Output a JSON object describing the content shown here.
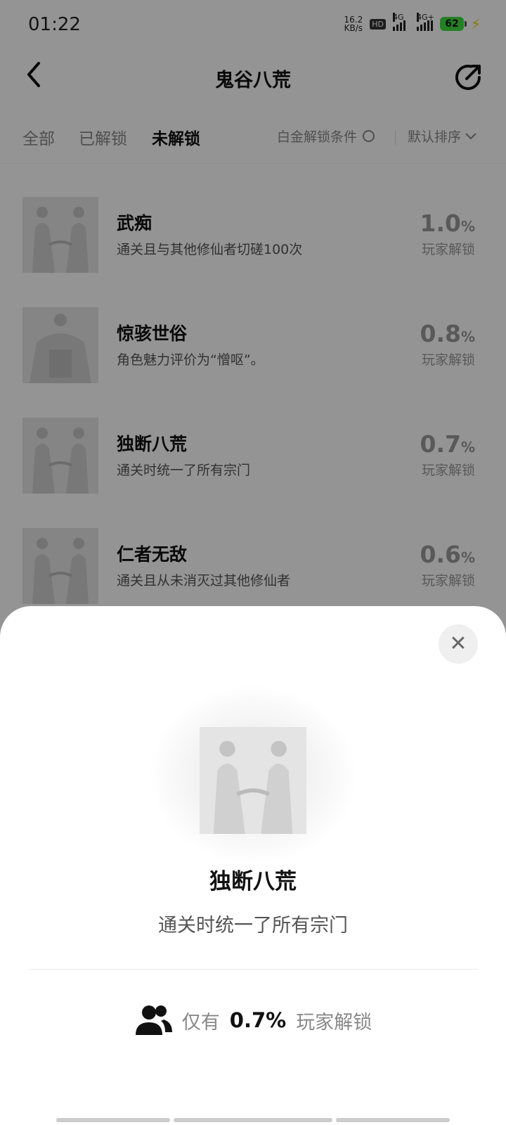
{
  "status": {
    "time": "01:22",
    "net_speed_value": "16.2",
    "net_speed_unit": "KB/s",
    "hd": "HD",
    "sim1": "4G",
    "sim2": "4G+",
    "battery": "62"
  },
  "header": {
    "title": "鬼谷八荒"
  },
  "tabs": [
    "全部",
    "已解锁",
    "未解锁"
  ],
  "filters": {
    "platinum": "白金解锁条件",
    "sort": "默认排序"
  },
  "achievements": [
    {
      "title": "武痴",
      "desc": "通关且与其他修仙者切磋100次",
      "pct": "1.0",
      "pct_unit": "%",
      "unlock": "玩家解锁",
      "icon": "two-figures"
    },
    {
      "title": "惊骇世俗",
      "desc": "角色魅力评价为“憎呕”。",
      "pct": "0.8",
      "pct_unit": "%",
      "unlock": "玩家解锁",
      "icon": "single-figure"
    },
    {
      "title": "独断八荒",
      "desc": "通关时统一了所有宗门",
      "pct": "0.7",
      "pct_unit": "%",
      "unlock": "玩家解锁",
      "icon": "two-figures"
    },
    {
      "title": "仁者无敌",
      "desc": "通关且从未消灭过其他修仙者",
      "pct": "0.6",
      "pct_unit": "%",
      "unlock": "玩家解锁",
      "icon": "two-figures"
    }
  ],
  "sheet": {
    "title": "独断八荒",
    "desc": "通关时统一了所有宗门",
    "stat_prefix": "仅有",
    "stat_value": "0.7%",
    "stat_suffix": "玩家解锁"
  }
}
